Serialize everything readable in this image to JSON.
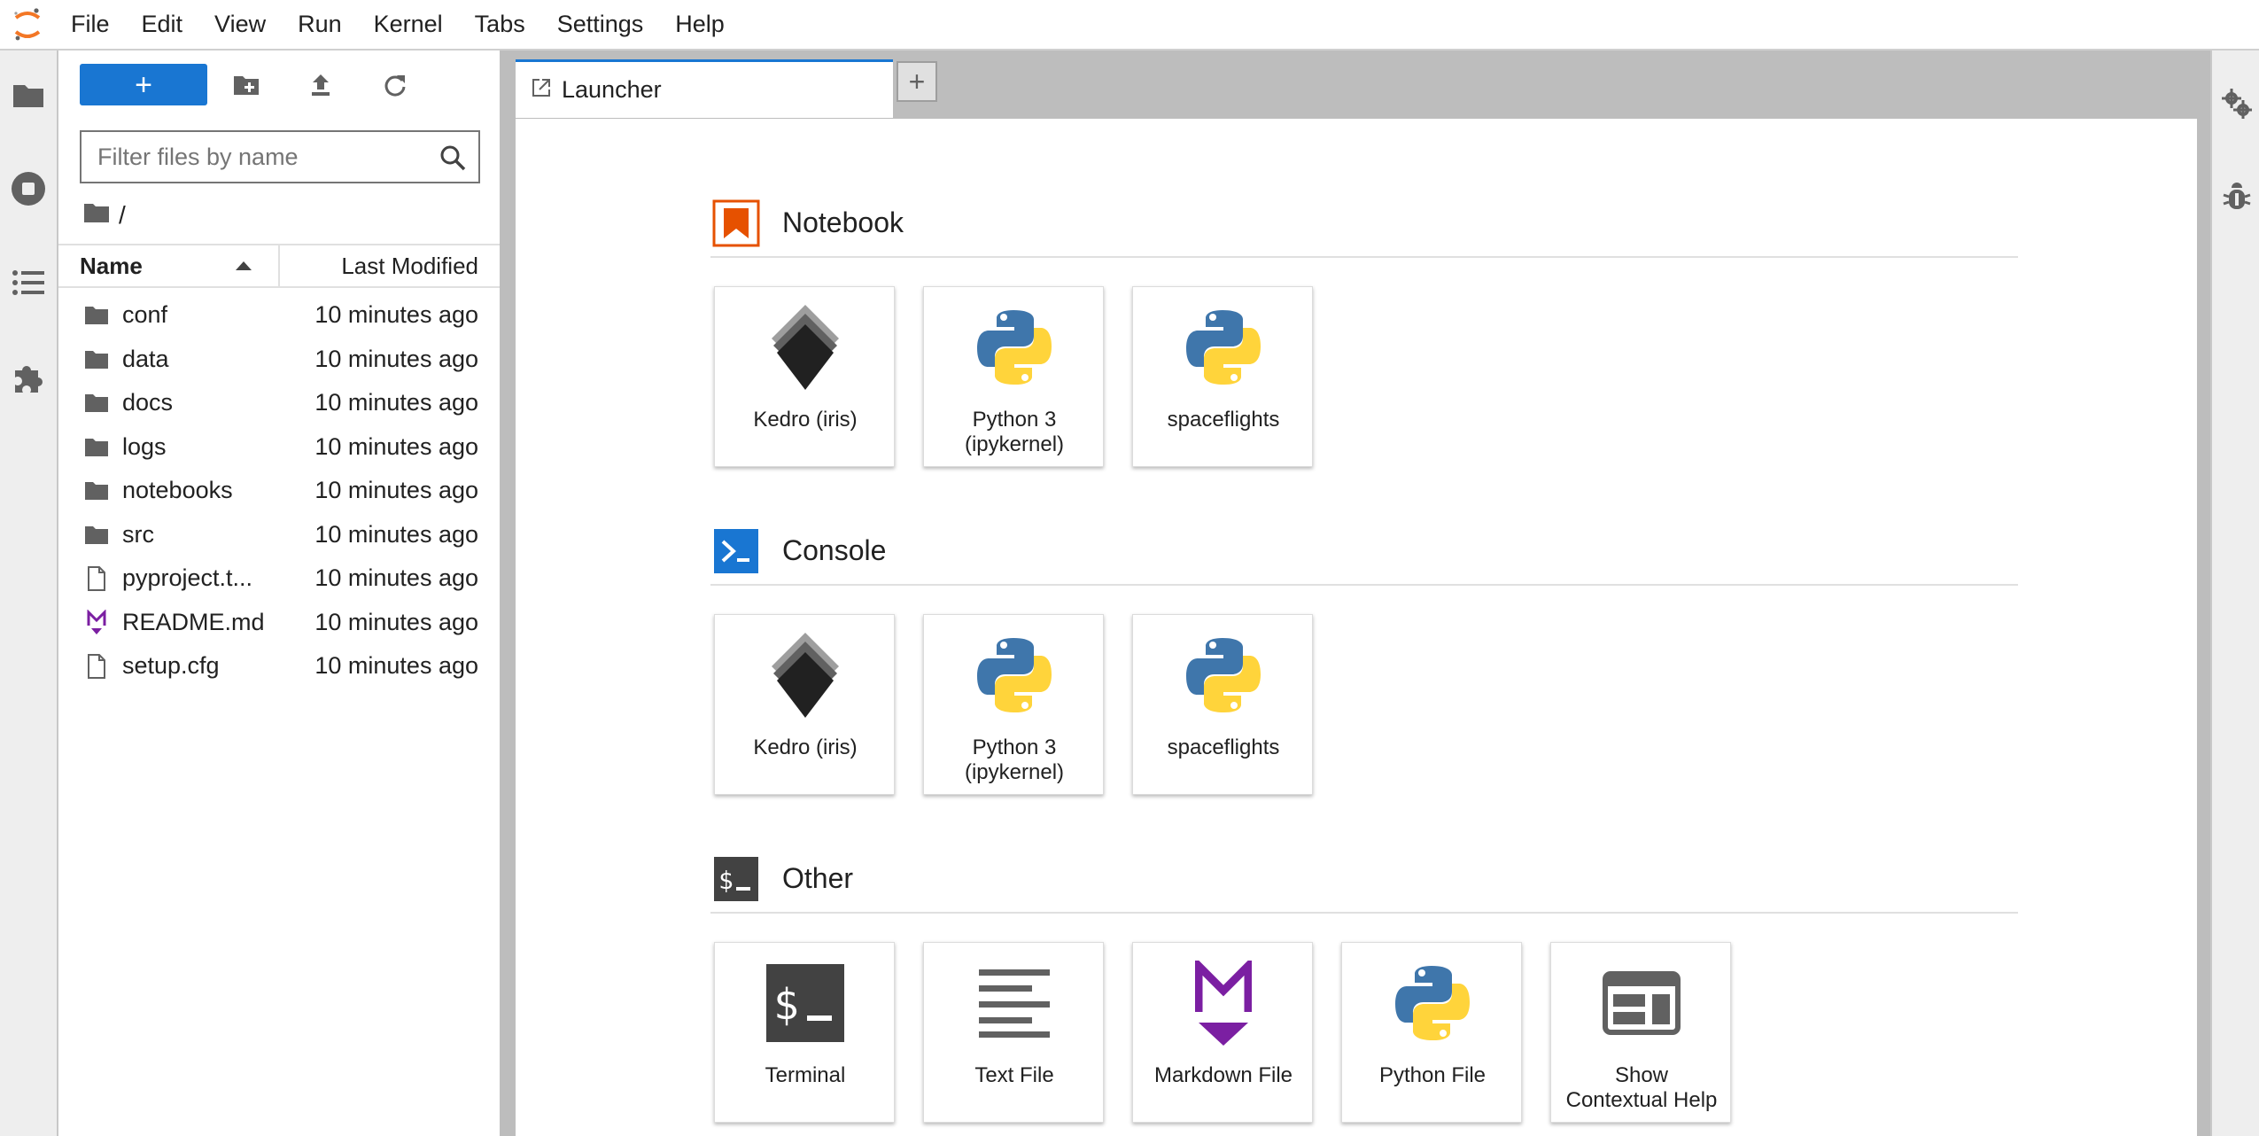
{
  "menubar": {
    "logo_icon": "jupyter-logo",
    "items": [
      "File",
      "Edit",
      "View",
      "Run",
      "Kernel",
      "Tabs",
      "Settings",
      "Help"
    ]
  },
  "leftbar": {
    "icons": [
      "folder-icon",
      "running-icon",
      "toc-icon",
      "extension-icon"
    ]
  },
  "filebrowser": {
    "toolbar": {
      "new_launcher_label": "+",
      "icons": [
        "new-folder-icon",
        "upload-icon",
        "refresh-icon"
      ]
    },
    "filter": {
      "placeholder": "Filter files by name",
      "value": ""
    },
    "breadcrumb": "/",
    "columns": {
      "name": "Name",
      "modified": "Last Modified"
    },
    "files": [
      {
        "name": "conf",
        "type": "folder",
        "modified": "10 minutes ago"
      },
      {
        "name": "data",
        "type": "folder",
        "modified": "10 minutes ago"
      },
      {
        "name": "docs",
        "type": "folder",
        "modified": "10 minutes ago"
      },
      {
        "name": "logs",
        "type": "folder",
        "modified": "10 minutes ago"
      },
      {
        "name": "notebooks",
        "type": "folder",
        "modified": "10 minutes ago"
      },
      {
        "name": "src",
        "type": "folder",
        "modified": "10 minutes ago"
      },
      {
        "name": "pyproject.t...",
        "type": "file",
        "modified": "10 minutes ago"
      },
      {
        "name": "README.md",
        "type": "markdown",
        "modified": "10 minutes ago"
      },
      {
        "name": "setup.cfg",
        "type": "file",
        "modified": "10 minutes ago"
      }
    ]
  },
  "tabs": {
    "active": {
      "label": "Launcher"
    },
    "add_label": "+"
  },
  "launcher": {
    "sections": [
      {
        "title": "Notebook",
        "icon": "notebook-icon",
        "cards": [
          {
            "label": "Kedro (iris)",
            "icon": "kedro-icon"
          },
          {
            "label": "Python 3\n(ipykernel)",
            "icon": "python-icon"
          },
          {
            "label": "spaceflights",
            "icon": "python-icon"
          }
        ]
      },
      {
        "title": "Console",
        "icon": "console-icon",
        "cards": [
          {
            "label": "Kedro (iris)",
            "icon": "kedro-icon"
          },
          {
            "label": "Python 3\n(ipykernel)",
            "icon": "python-icon"
          },
          {
            "label": "spaceflights",
            "icon": "python-icon"
          }
        ]
      },
      {
        "title": "Other",
        "icon": "other-icon",
        "cards": [
          {
            "label": "Terminal",
            "icon": "terminal-icon"
          },
          {
            "label": "Text File",
            "icon": "text-file-icon"
          },
          {
            "label": "Markdown File",
            "icon": "markdown-icon"
          },
          {
            "label": "Python File",
            "icon": "python-icon"
          },
          {
            "label": "Show\nContextual Help",
            "icon": "help-icon"
          }
        ]
      }
    ]
  },
  "rightbar": {
    "icons": [
      "property-inspector-icon",
      "debugger-icon"
    ]
  },
  "colors": {
    "accent": "#1976d2",
    "notebook": "#e65100",
    "console": "#1976d2",
    "markdown": "#7b1fa2",
    "python_blue": "#3f76ab",
    "python_yellow": "#ffd43b"
  }
}
